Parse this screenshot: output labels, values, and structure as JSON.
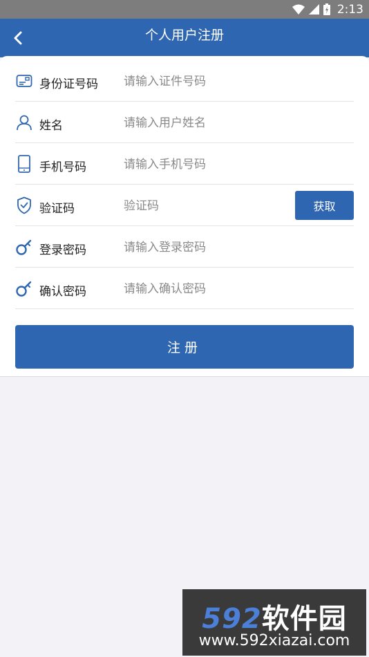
{
  "status_bar": {
    "time": "2:13"
  },
  "header": {
    "title": "个人用户注册"
  },
  "form": {
    "fields": [
      {
        "icon": "id-card-icon",
        "label": "身份证号码",
        "placeholder": "请输入证件号码"
      },
      {
        "icon": "user-icon",
        "label": "姓名",
        "placeholder": "请输入用户姓名"
      },
      {
        "icon": "phone-icon",
        "label": "手机号码",
        "placeholder": "请输入手机号码"
      },
      {
        "icon": "shield-check-icon",
        "label": "验证码",
        "placeholder": "验证码",
        "button": "获取"
      },
      {
        "icon": "key-icon",
        "label": "登录密码",
        "placeholder": "请输入登录密码"
      },
      {
        "icon": "key-icon",
        "label": "确认密码",
        "placeholder": "请输入确认密码"
      }
    ],
    "submit_label": "注册"
  },
  "watermark": {
    "logo_digits": "592",
    "logo_text": "软件园",
    "url": "www.592xiazai.com"
  },
  "colors": {
    "primary": "#2f66b1",
    "status_bar": "#7d7d7d",
    "background": "#f2f2f7"
  }
}
